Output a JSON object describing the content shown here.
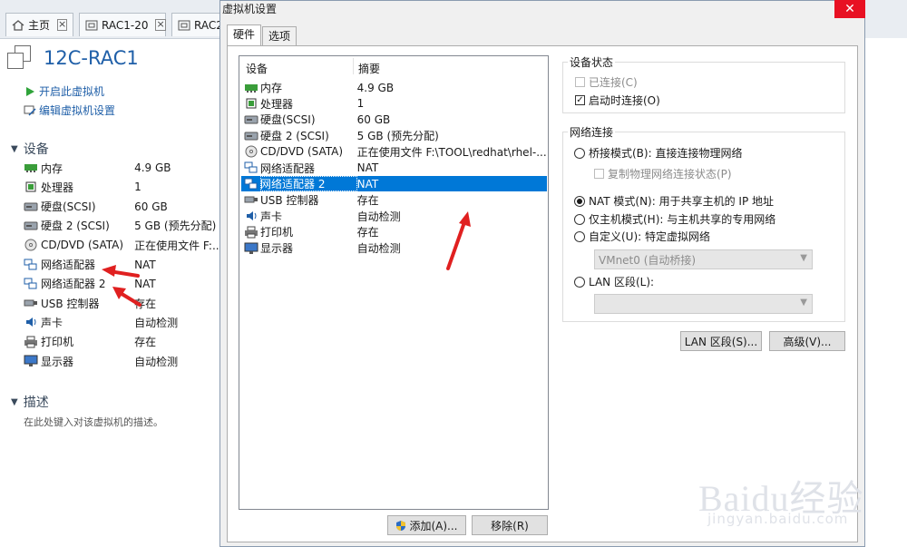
{
  "tabs": [
    {
      "label": "主页",
      "icon": "home-icon"
    },
    {
      "label": "RAC1-20",
      "icon": "vm-tab-icon"
    },
    {
      "label": "RAC2",
      "icon": "vm-tab-icon"
    }
  ],
  "vm": {
    "title": "12C-RAC1",
    "actions": [
      "开启此虚拟机",
      "编辑虚拟机设置"
    ],
    "devices_section": "设备",
    "devices": [
      {
        "name": "内存",
        "value": "4.9 GB",
        "icon": "memory-icon"
      },
      {
        "name": "处理器",
        "value": "1",
        "icon": "cpu-icon"
      },
      {
        "name": "硬盘(SCSI)",
        "value": "60 GB",
        "icon": "disk-icon"
      },
      {
        "name": "硬盘 2 (SCSI)",
        "value": "5 GB (预先分配)",
        "icon": "disk-icon"
      },
      {
        "name": "CD/DVD (SATA)",
        "value": "正在使用文件 F:...",
        "icon": "cd-icon"
      },
      {
        "name": "网络适配器",
        "value": "NAT",
        "icon": "network-icon"
      },
      {
        "name": "网络适配器 2",
        "value": "NAT",
        "icon": "network-icon"
      },
      {
        "name": "USB 控制器",
        "value": "存在",
        "icon": "usb-icon"
      },
      {
        "name": "声卡",
        "value": "自动检测",
        "icon": "sound-icon"
      },
      {
        "name": "打印机",
        "value": "存在",
        "icon": "printer-icon"
      },
      {
        "name": "显示器",
        "value": "自动检测",
        "icon": "monitor-icon"
      }
    ],
    "description_section": "描述",
    "description_hint": "在此处键入对该虚拟机的描述。"
  },
  "dialog": {
    "title": "虚拟机设置",
    "close_label": "✕",
    "tabs": [
      "硬件",
      "选项"
    ],
    "active_tab": 0,
    "list_header": {
      "device": "设备",
      "summary": "摘要"
    },
    "devices": [
      {
        "name": "内存",
        "value": "4.9 GB",
        "icon": "memory-icon"
      },
      {
        "name": "处理器",
        "value": "1",
        "icon": "cpu-icon"
      },
      {
        "name": "硬盘(SCSI)",
        "value": "60 GB",
        "icon": "disk-icon"
      },
      {
        "name": "硬盘 2 (SCSI)",
        "value": "5 GB (预先分配)",
        "icon": "disk-icon"
      },
      {
        "name": "CD/DVD (SATA)",
        "value": "正在使用文件 F:\\TOOL\\redhat\\rhel-...",
        "icon": "cd-icon"
      },
      {
        "name": "网络适配器",
        "value": "NAT",
        "icon": "network-icon"
      },
      {
        "name": "网络适配器 2",
        "value": "NAT",
        "icon": "network-icon"
      },
      {
        "name": "USB 控制器",
        "value": "存在",
        "icon": "usb-icon"
      },
      {
        "name": "声卡",
        "value": "自动检测",
        "icon": "sound-icon"
      },
      {
        "name": "打印机",
        "value": "存在",
        "icon": "printer-icon"
      },
      {
        "name": "显示器",
        "value": "自动检测",
        "icon": "monitor-icon"
      }
    ],
    "selected_index": 6,
    "add_button": "添加(A)...",
    "remove_button": "移除(R)",
    "device_status": {
      "title": "设备状态",
      "connected": {
        "label": "已连接(C)",
        "checked": false,
        "disabled": true
      },
      "connect_on_power": {
        "label": "启动时连接(O)",
        "checked": true,
        "disabled": false
      }
    },
    "network": {
      "title": "网络连接",
      "bridged": {
        "label": "桥接模式(B): 直接连接物理网络",
        "selected": false
      },
      "replicate": {
        "label": "复制物理网络连接状态(P)",
        "checked": false,
        "disabled": true
      },
      "nat": {
        "label": "NAT 模式(N): 用于共享主机的 IP 地址",
        "selected": true
      },
      "hostonly": {
        "label": "仅主机模式(H): 与主机共享的专用网络",
        "selected": false
      },
      "custom": {
        "label": "自定义(U): 特定虚拟网络",
        "selected": false
      },
      "custom_value": "VMnet0 (自动桥接)",
      "lan": {
        "label": "LAN 区段(L):",
        "selected": false
      },
      "lan_value": "",
      "lan_button": "LAN 区段(S)...",
      "advanced_button": "高级(V)..."
    }
  },
  "watermark": {
    "text": "Baidu经验",
    "sub": "jingyan.baidu.com"
  },
  "colors": {
    "selection": "#0078d7",
    "close": "#e81123",
    "link": "#1f5fa8",
    "arrow": "#e02020"
  }
}
